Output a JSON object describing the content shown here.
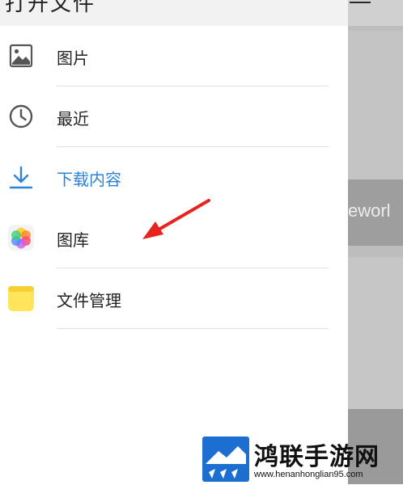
{
  "drawer": {
    "title": "打开文件",
    "items": [
      {
        "label": "图片",
        "icon": "image-icon"
      },
      {
        "label": "最近",
        "icon": "clock-icon"
      },
      {
        "label": "下载内容",
        "icon": "download-icon",
        "active": true
      },
      {
        "label": "图库",
        "icon": "gallery-icon"
      },
      {
        "label": "文件管理",
        "icon": "folder-icon"
      }
    ]
  },
  "background": {
    "banner_text": "eworl"
  },
  "annotation": {
    "arrow_color": "#e8231f",
    "points_to": "图库"
  },
  "watermark": {
    "title": "鸿联手游网",
    "url": "www.henanhonglian95.com"
  },
  "colors": {
    "accent": "#2b84d8",
    "text": "#222222",
    "folder": "#ffe45c",
    "arrow": "#e8231f"
  }
}
